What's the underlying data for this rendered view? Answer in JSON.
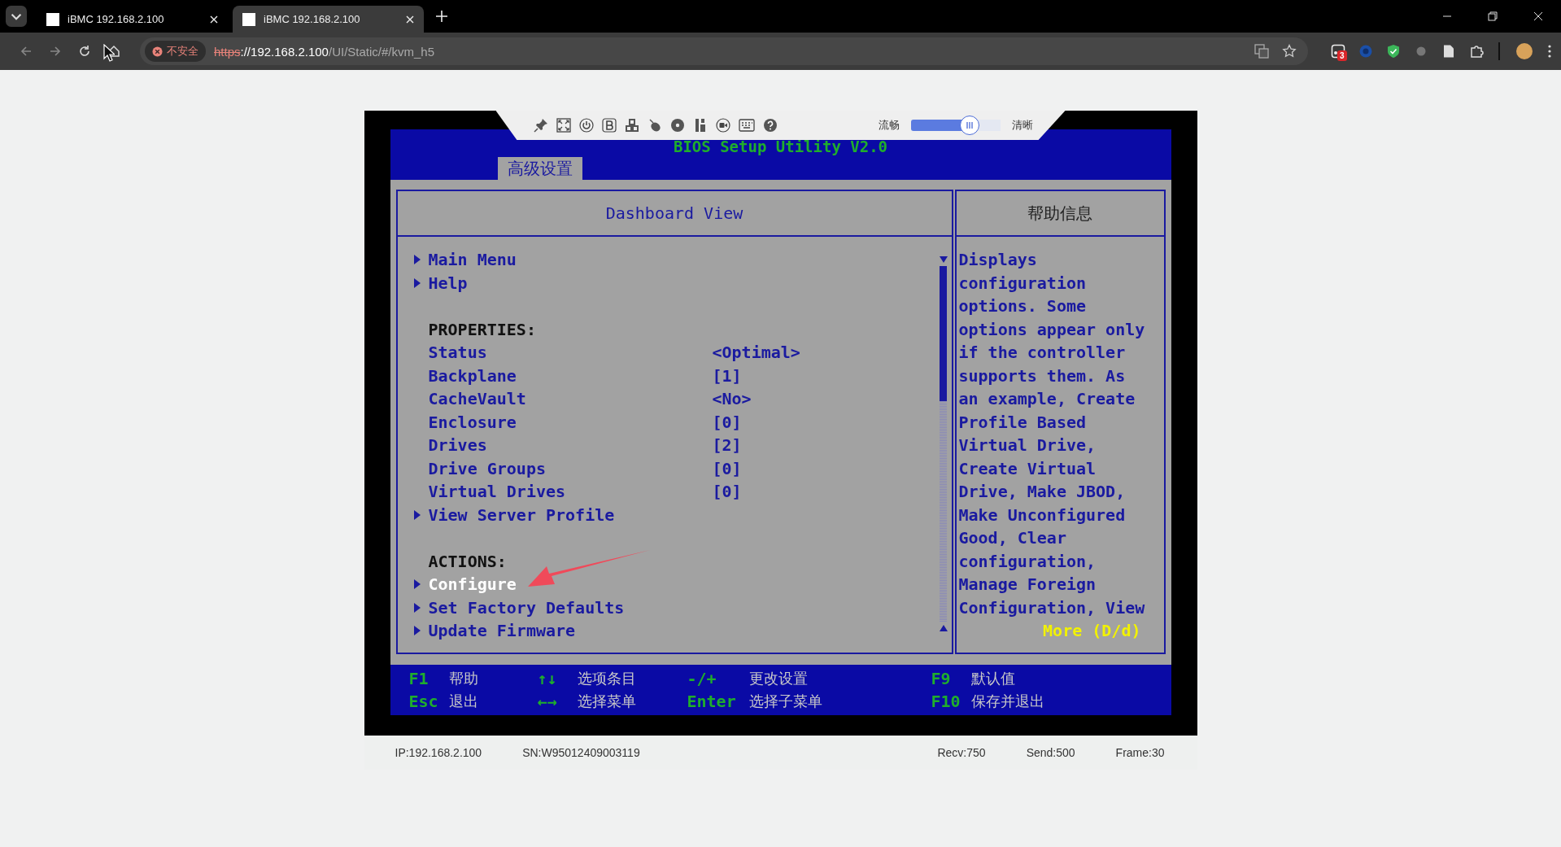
{
  "browser": {
    "tabs": [
      {
        "title": "iBMC 192.168.2.100",
        "selected": false
      },
      {
        "title": "iBMC 192.168.2.100",
        "selected": true
      }
    ],
    "address": {
      "security": "不安全",
      "scheme": "https",
      "host": "://192.168.2.100",
      "path": "/UI/Static/#/kvm_h5"
    },
    "extension_badge": "3"
  },
  "kvm_toolbar": {
    "slider": {
      "left_label": "流畅",
      "right_label": "清晰",
      "level": 0.66
    }
  },
  "bios": {
    "title": "BIOS Setup Utility V2.0",
    "tabs": [
      {
        "label": "高级设置",
        "selected": true
      }
    ],
    "panel_title": "Dashboard View",
    "items": [
      {
        "kind": "link",
        "label": "Main Menu",
        "selected": false
      },
      {
        "kind": "link",
        "label": "Help",
        "selected": false
      },
      {
        "kind": "heading",
        "label": "PROPERTIES:",
        "selected": false
      },
      {
        "kind": "property",
        "label": "Status",
        "value": "<Optimal>",
        "selected": false
      },
      {
        "kind": "property",
        "label": "Backplane",
        "value": "[1]",
        "selected": false
      },
      {
        "kind": "property",
        "label": "CacheVault",
        "value": "<No>",
        "selected": false
      },
      {
        "kind": "property",
        "label": "Enclosure",
        "value": "[0]",
        "selected": false
      },
      {
        "kind": "property",
        "label": "Drives",
        "value": "[2]",
        "selected": false
      },
      {
        "kind": "property",
        "label": "Drive Groups",
        "value": "[0]",
        "selected": false
      },
      {
        "kind": "property",
        "label": "Virtual Drives",
        "value": "[0]",
        "selected": false
      },
      {
        "kind": "link",
        "label": "View Server Profile",
        "selected": false
      },
      {
        "kind": "heading",
        "label": "ACTIONS:",
        "selected": false
      },
      {
        "kind": "link",
        "label": "Configure",
        "selected": true
      },
      {
        "kind": "link",
        "label": "Set Factory Defaults",
        "selected": false
      },
      {
        "kind": "link",
        "label": "Update Firmware",
        "selected": false
      }
    ],
    "help_title": "帮助信息",
    "help_text": "Displays configuration options. Some options appear only if the controller supports them. As an example, Create Profile Based Virtual Drive, Create Virtual Drive, Make JBOD, Make Unconfigured Good, Clear configuration, Manage Foreign Configuration, View",
    "help_more": "More (D/d)",
    "keys": [
      {
        "key": "F1",
        "action": "帮助"
      },
      {
        "key": "Esc",
        "action": "退出"
      },
      {
        "key": "↑↓",
        "action": "选项条目"
      },
      {
        "key": "←→",
        "action": "选择菜单"
      },
      {
        "key": "-/+",
        "action": "更改设置"
      },
      {
        "key": "Enter",
        "action": "选择子菜单"
      },
      {
        "key": "F9",
        "action": "默认值"
      },
      {
        "key": "F10",
        "action": "保存并退出"
      }
    ]
  },
  "status_bar": {
    "ip": "IP:192.168.2.100",
    "sn": "SN:W95012409003119",
    "recv": "Recv:750",
    "send": "Send:500",
    "frame": "Frame:30"
  }
}
